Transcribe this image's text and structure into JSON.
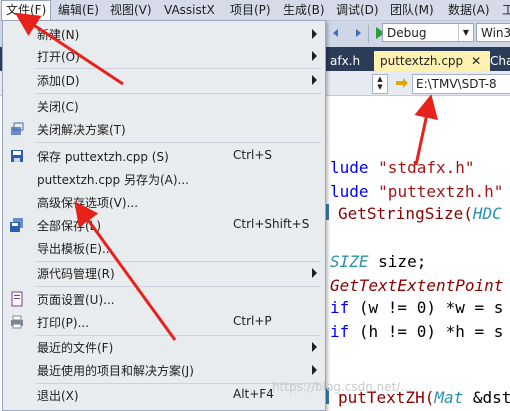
{
  "menubar": {
    "items": [
      "文件(F)",
      "编辑(E)",
      "视图(V)",
      "VAssistX",
      "项目(P)",
      "生成(B)",
      "调试(D)",
      "团队(M)",
      "数据(A)",
      "工"
    ]
  },
  "toolbar": {
    "config": "Debug",
    "platform": "Win3"
  },
  "tabs": {
    "left_partial": "afx.h",
    "active": "puttextzh.cpp",
    "right_partial": "Cha"
  },
  "navbar": {
    "path": "E:\\TMV\\SDT-8"
  },
  "code": {
    "line1_kw": "lude",
    "line1_str": "\"stdafx.h\"",
    "line2_kw": "lude",
    "line2_str": "\"puttextzh.h\"",
    "line3_fn": "GetStringSize(",
    "line3_ty": "HDC",
    "line4_ty": "SIZE",
    "line4_rest": " size;",
    "line5_fn": "GetTextExtentPoint",
    "line6_a": "if",
    "line6_b": " (w != ",
    "line6_c": "0",
    "line6_d": ") *w = s",
    "line7_a": "if",
    "line7_b": " (h != ",
    "line7_c": "0",
    "line7_d": ") *h = s",
    "line8_fn": "putTextZH(",
    "line8_ty": "Mat",
    "line8_rest": " &dst"
  },
  "filemenu": {
    "new": "新建(N)",
    "open": "打开(O)",
    "add": "添加(D)",
    "close": "关闭(C)",
    "close_solution": "关闭解决方案(T)",
    "save": "保存 puttextzh.cpp (S)",
    "save_shortcut": "Ctrl+S",
    "save_as": "puttextzh.cpp 另存为(A)...",
    "adv_save": "高级保存选项(V)...",
    "save_all": "全部保存(L)",
    "save_all_shortcut": "Ctrl+Shift+S",
    "export_template": "导出模板(E)...",
    "source_control": "源代码管理(R)",
    "page_setup": "页面设置(U)...",
    "print": "打印(P)...",
    "print_shortcut": "Ctrl+P",
    "recent_files": "最近的文件(F)",
    "recent_projects": "最近使用的项目和解决方案(J)",
    "exit": "退出(X)",
    "exit_shortcut": "Alt+F4"
  },
  "watermark": "https://blog.csdn.net/..."
}
